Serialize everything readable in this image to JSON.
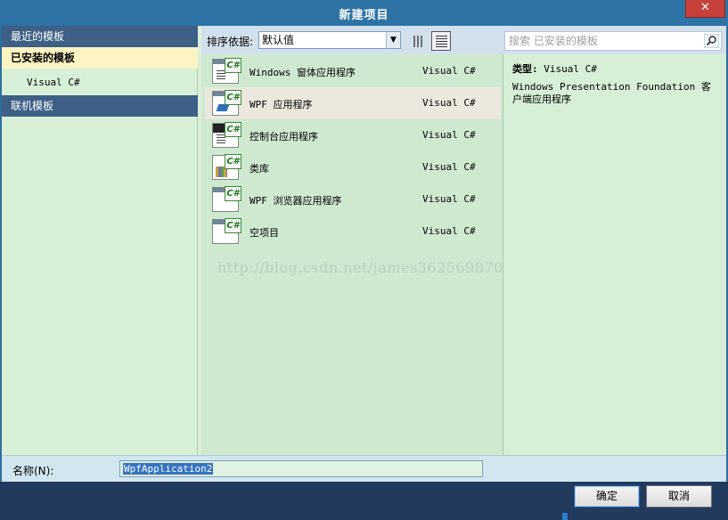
{
  "window": {
    "title": "新建项目",
    "close_glyph": "✕"
  },
  "left_pane": {
    "items": [
      {
        "label": "最近的模板"
      },
      {
        "label": "已安装的模板"
      },
      {
        "label": "Visual C#"
      },
      {
        "label": "联机模板"
      }
    ]
  },
  "toolbar": {
    "sort_label": "排序依据:",
    "sort_value": "默认值",
    "search_placeholder": "搜索 已安装的模板"
  },
  "templates": [
    {
      "name": "Windows 窗体应用程序",
      "lang": "Visual C#",
      "icon": "winforms-icon"
    },
    {
      "name": "WPF 应用程序",
      "lang": "Visual C#",
      "icon": "wpf-icon",
      "selected": true
    },
    {
      "name": "控制台应用程序",
      "lang": "Visual C#",
      "icon": "console-icon"
    },
    {
      "name": "类库",
      "lang": "Visual C#",
      "icon": "class-library-icon"
    },
    {
      "name": "WPF 浏览器应用程序",
      "lang": "Visual C#",
      "icon": "wpf-browser-icon"
    },
    {
      "name": "空项目",
      "lang": "Visual C#",
      "icon": "empty-project-icon"
    }
  ],
  "watermark": "http://blog.csdn.net/james362569870",
  "description": {
    "type_label": "类型:",
    "type_value": "Visual C#",
    "text": "Windows Presentation Foundation 客户端应用程序"
  },
  "name_field": {
    "label": "名称(N):",
    "value": "WpfApplication2"
  },
  "buttons": {
    "ok": "确定",
    "cancel": "取消"
  },
  "colors": {
    "title_bar": "#2e73a6",
    "selected_row": "#ece8dd",
    "list_bg": "#cfe9d0",
    "footer": "#233a5f"
  }
}
